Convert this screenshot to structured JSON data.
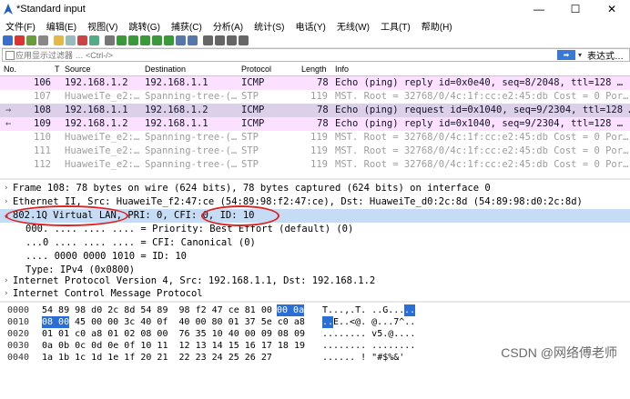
{
  "window": {
    "title": "*Standard input",
    "min": "—",
    "max": "☐",
    "close": "✕"
  },
  "menu": [
    "文件(F)",
    "编辑(E)",
    "视图(V)",
    "跳转(G)",
    "捕获(C)",
    "分析(A)",
    "统计(S)",
    "电话(Y)",
    "无线(W)",
    "工具(T)",
    "帮助(H)"
  ],
  "filter": {
    "placeholder": "应用显示过滤器 … <Ctrl-/>",
    "arrow": "➡",
    "dropdown": "▾",
    "expression": "表达式…"
  },
  "columns": {
    "no": "No.",
    "time": "T",
    "source": "Source",
    "destination": "Destination",
    "protocol": "Protocol",
    "length": "Length",
    "info": "Info"
  },
  "packets": [
    {
      "no": "106",
      "source": "192.168.1.2",
      "dest": "192.168.1.1",
      "proto": "ICMP",
      "len": "78",
      "info": "Echo (ping) reply    id=0x0e40, seq=8/2048, ttl=128 …",
      "kind": "pink"
    },
    {
      "no": "107",
      "source": "HuaweiTe_e2:…",
      "dest": "Spanning-tree-(…",
      "proto": "STP",
      "len": "119",
      "info": "MST. Root = 32768/0/4c:1f:cc:e2:45:db  Cost = 0  Por…",
      "kind": "stp"
    },
    {
      "no": "108",
      "source": "192.168.1.1",
      "dest": "192.168.1.2",
      "proto": "ICMP",
      "len": "78",
      "info": "Echo (ping) request  id=0x1040, seq=9/2304, ttl=128 …",
      "kind": "sel"
    },
    {
      "no": "109",
      "source": "192.168.1.2",
      "dest": "192.168.1.1",
      "proto": "ICMP",
      "len": "78",
      "info": "Echo (ping) reply    id=0x1040, seq=9/2304, ttl=128 …",
      "kind": "pink"
    },
    {
      "no": "110",
      "source": "HuaweiTe_e2:…",
      "dest": "Spanning-tree-(…",
      "proto": "STP",
      "len": "119",
      "info": "MST. Root = 32768/0/4c:1f:cc:e2:45:db  Cost = 0  Por…",
      "kind": "stp"
    },
    {
      "no": "111",
      "source": "HuaweiTe_e2:…",
      "dest": "Spanning-tree-(…",
      "proto": "STP",
      "len": "119",
      "info": "MST. Root = 32768/0/4c:1f:cc:e2:45:db  Cost = 0  Por…",
      "kind": "stp"
    },
    {
      "no": "112",
      "source": "HuaweiTe_e2:…",
      "dest": "Spanning-tree-(…",
      "proto": "STP",
      "len": "119",
      "info": "MST. Root = 32768/0/4c:1f:cc:e2:45:db  Cost = 0  Por…",
      "kind": "stp"
    }
  ],
  "details": [
    {
      "arrow": "›",
      "indent": 0,
      "text": "Frame 108: 78 bytes on wire (624 bits), 78 bytes captured (624 bits) on interface 0"
    },
    {
      "arrow": "›",
      "indent": 0,
      "text": "Ethernet II, Src: HuaweiTe_f2:47:ce (54:89:98:f2:47:ce), Dst: HuaweiTe_d0:2c:8d (54:89:98:d0:2c:8d)"
    },
    {
      "arrow": "⌄",
      "indent": 0,
      "text": "802.1Q Virtual LAN, PRI: 0, CFI: 0, ID: 10",
      "selected": true
    },
    {
      "arrow": "",
      "indent": 2,
      "text": "000. .... .... .... = Priority: Best Effort (default) (0)"
    },
    {
      "arrow": "",
      "indent": 2,
      "text": "...0 .... .... .... = CFI: Canonical (0)"
    },
    {
      "arrow": "",
      "indent": 2,
      "text": ".... 0000 0000 1010 = ID: 10"
    },
    {
      "arrow": "",
      "indent": 2,
      "text": "Type: IPv4 (0x0800)"
    },
    {
      "arrow": "›",
      "indent": 0,
      "text": "Internet Protocol Version 4, Src: 192.168.1.1, Dst: 192.168.1.2"
    },
    {
      "arrow": "›",
      "indent": 0,
      "text": "Internet Control Message Protocol"
    }
  ],
  "hex": [
    {
      "offset": "0000",
      "bytes_a": "54 89 98 d0 2c 8d 54 89  98 f2 47 ce 81 00 ",
      "bytes_hl": "00 0a",
      "ascii_a": "T...,.T. ..G...",
      "ascii_hl": ".."
    },
    {
      "offset": "0010",
      "bytes_pre_hl": "08 00",
      "bytes_a": " 45 00 00 3c 40 0f  40 00 80 01 37 5e c0 a8",
      "ascii_pre_hl": "..",
      "ascii_a": "E..<@. @...7^.."
    },
    {
      "offset": "0020",
      "bytes_a": "01 01 c0 a8 01 02 08 00  76 35 10 40 00 09 08 09",
      "ascii_a": "........ v5.@...."
    },
    {
      "offset": "0030",
      "bytes_a": "0a 0b 0c 0d 0e 0f 10 11  12 13 14 15 16 17 18 19",
      "ascii_a": "........ ........"
    },
    {
      "offset": "0040",
      "bytes_a": "1a 1b 1c 1d 1e 1f 20 21  22 23 24 25 26 27",
      "ascii_a": "...... ! \"#$%&'"
    }
  ],
  "watermark": "CSDN @网络傅老师",
  "colors": {
    "pink_row": "#fce0ff",
    "selected_row": "#dcd0e8",
    "detail_selected": "#c6dcf5",
    "highlight": "#2b6fd6",
    "annotation": "#e02020"
  }
}
